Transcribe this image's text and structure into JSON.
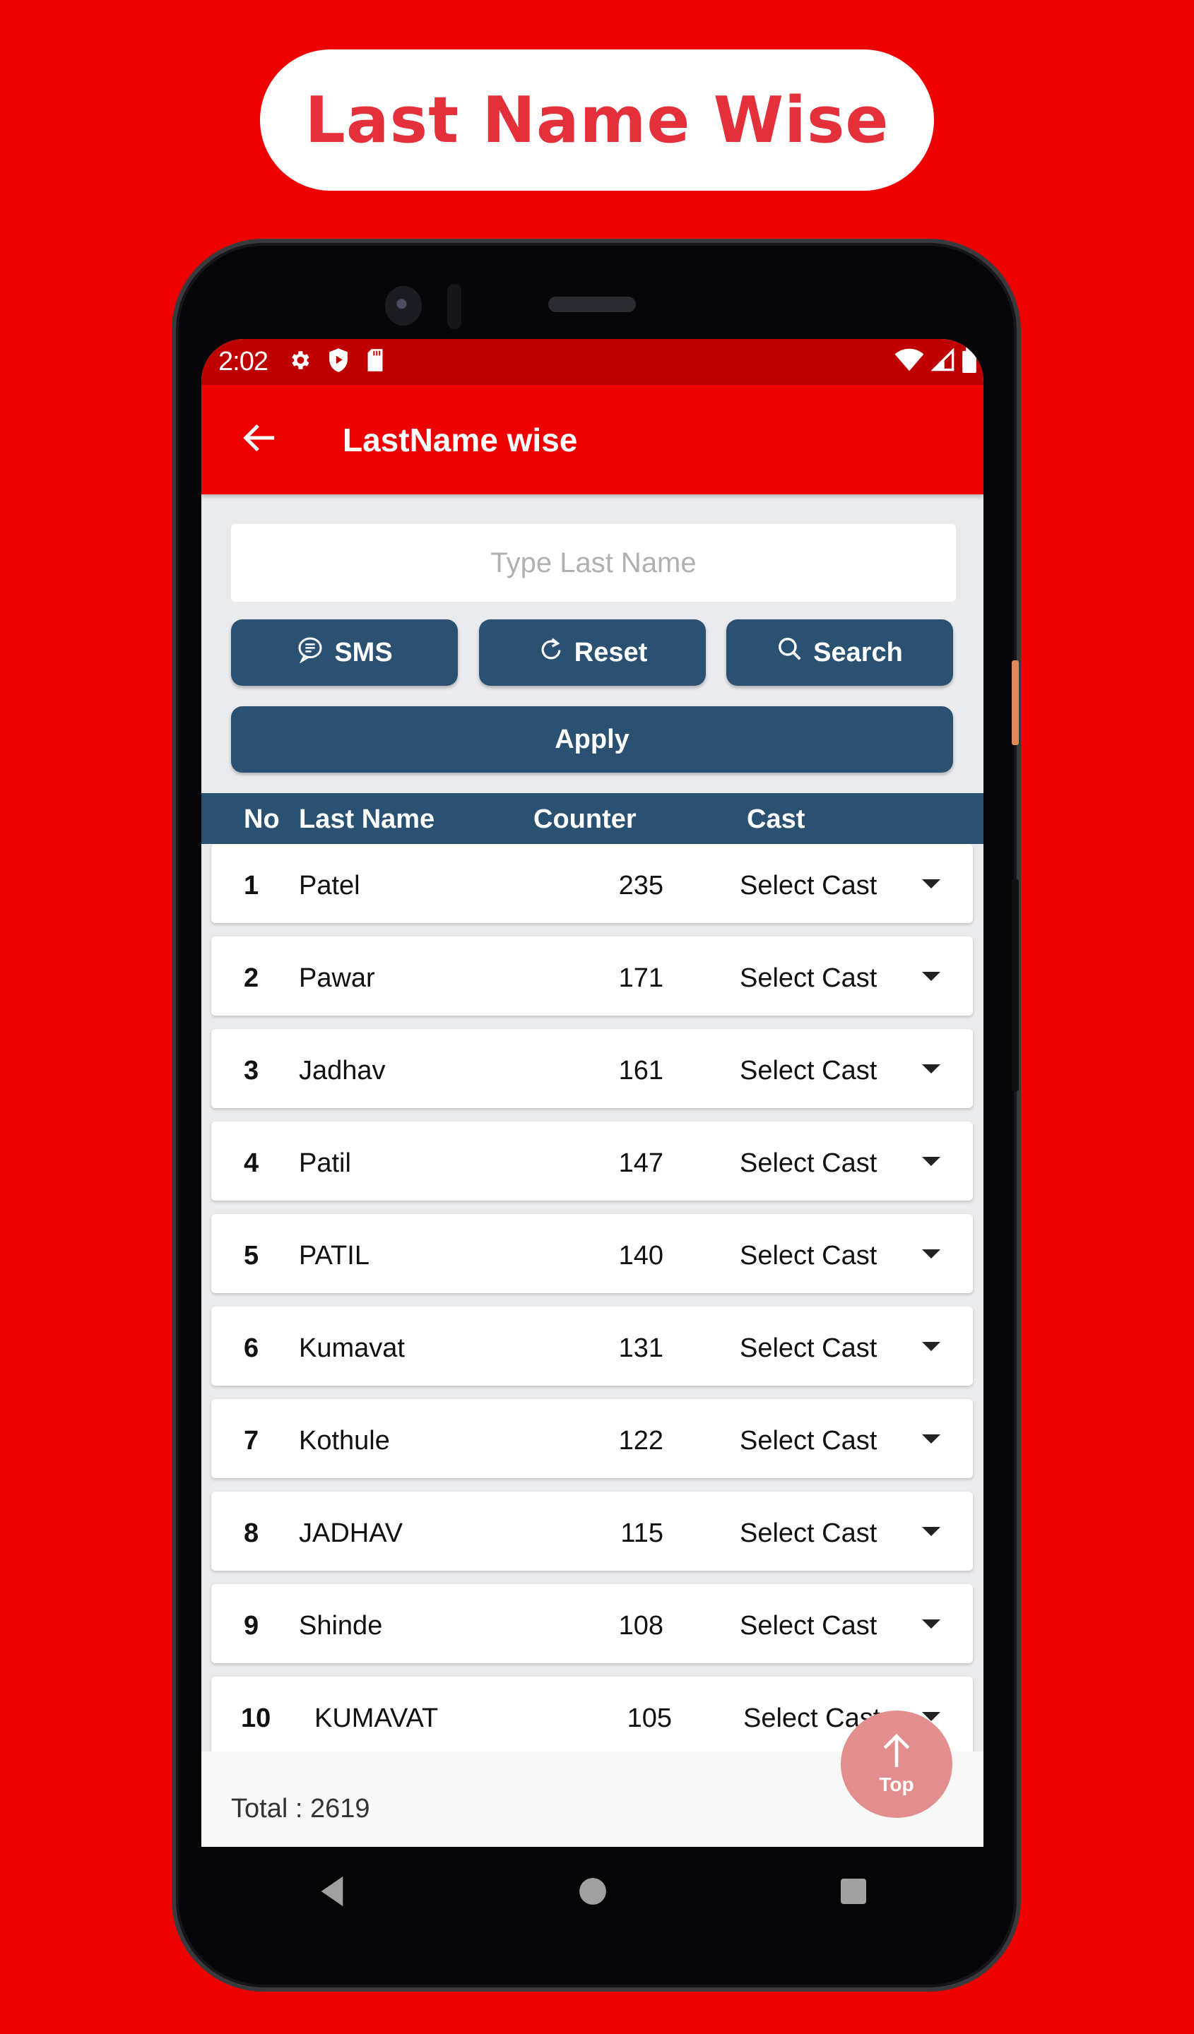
{
  "banner": {
    "title": "Last Name Wise"
  },
  "statusbar": {
    "time": "2:02",
    "left_icons": [
      "gear-icon",
      "shield-play-icon",
      "sd-card-icon"
    ],
    "right_icons": [
      "wifi-icon",
      "signal-icon",
      "battery-icon"
    ]
  },
  "appbar": {
    "title": "LastName wise",
    "back_icon": "arrow-left-icon"
  },
  "search": {
    "placeholder": "Type Last Name",
    "value": ""
  },
  "buttons": {
    "sms": {
      "label": "SMS",
      "icon": "chat-bubble-icon"
    },
    "reset": {
      "label": "Reset",
      "icon": "refresh-icon"
    },
    "search": {
      "label": "Search",
      "icon": "search-icon"
    },
    "apply": {
      "label": "Apply"
    }
  },
  "table": {
    "columns": [
      "No",
      "Last Name",
      "Counter",
      "Cast"
    ],
    "rows": [
      {
        "no": "1",
        "name": "Patel",
        "counter": "235",
        "cast": "Select Cast"
      },
      {
        "no": "2",
        "name": "Pawar",
        "counter": "171",
        "cast": "Select Cast"
      },
      {
        "no": "3",
        "name": "Jadhav",
        "counter": "161",
        "cast": "Select Cast"
      },
      {
        "no": "4",
        "name": "Patil",
        "counter": "147",
        "cast": "Select Cast"
      },
      {
        "no": "5",
        "name": "PATIL",
        "counter": "140",
        "cast": "Select Cast"
      },
      {
        "no": "6",
        "name": "Kumavat",
        "counter": "131",
        "cast": "Select Cast"
      },
      {
        "no": "7",
        "name": "Kothule",
        "counter": "122",
        "cast": "Select Cast"
      },
      {
        "no": "8",
        "name": "JADHAV",
        "counter": "115",
        "cast": "Select Cast"
      },
      {
        "no": "9",
        "name": "Shinde",
        "counter": "108",
        "cast": "Select Cast"
      },
      {
        "no": "10",
        "name": "KUMAVAT",
        "counter": "105",
        "cast": "Select Cast"
      }
    ]
  },
  "footer": {
    "total": "Total : 2619"
  },
  "fab": {
    "label": "Top",
    "icon": "arrow-up-icon"
  },
  "navbar": {
    "icons": [
      "back-triangle-icon",
      "home-circle-icon",
      "recents-square-icon"
    ]
  },
  "colors": {
    "background": "#ee0000",
    "appbar": "#ee0000",
    "statusbar": "#bf0000",
    "primary_button": "#2b5172",
    "banner_text": "#e4303a",
    "fab": "#e38e8e"
  }
}
